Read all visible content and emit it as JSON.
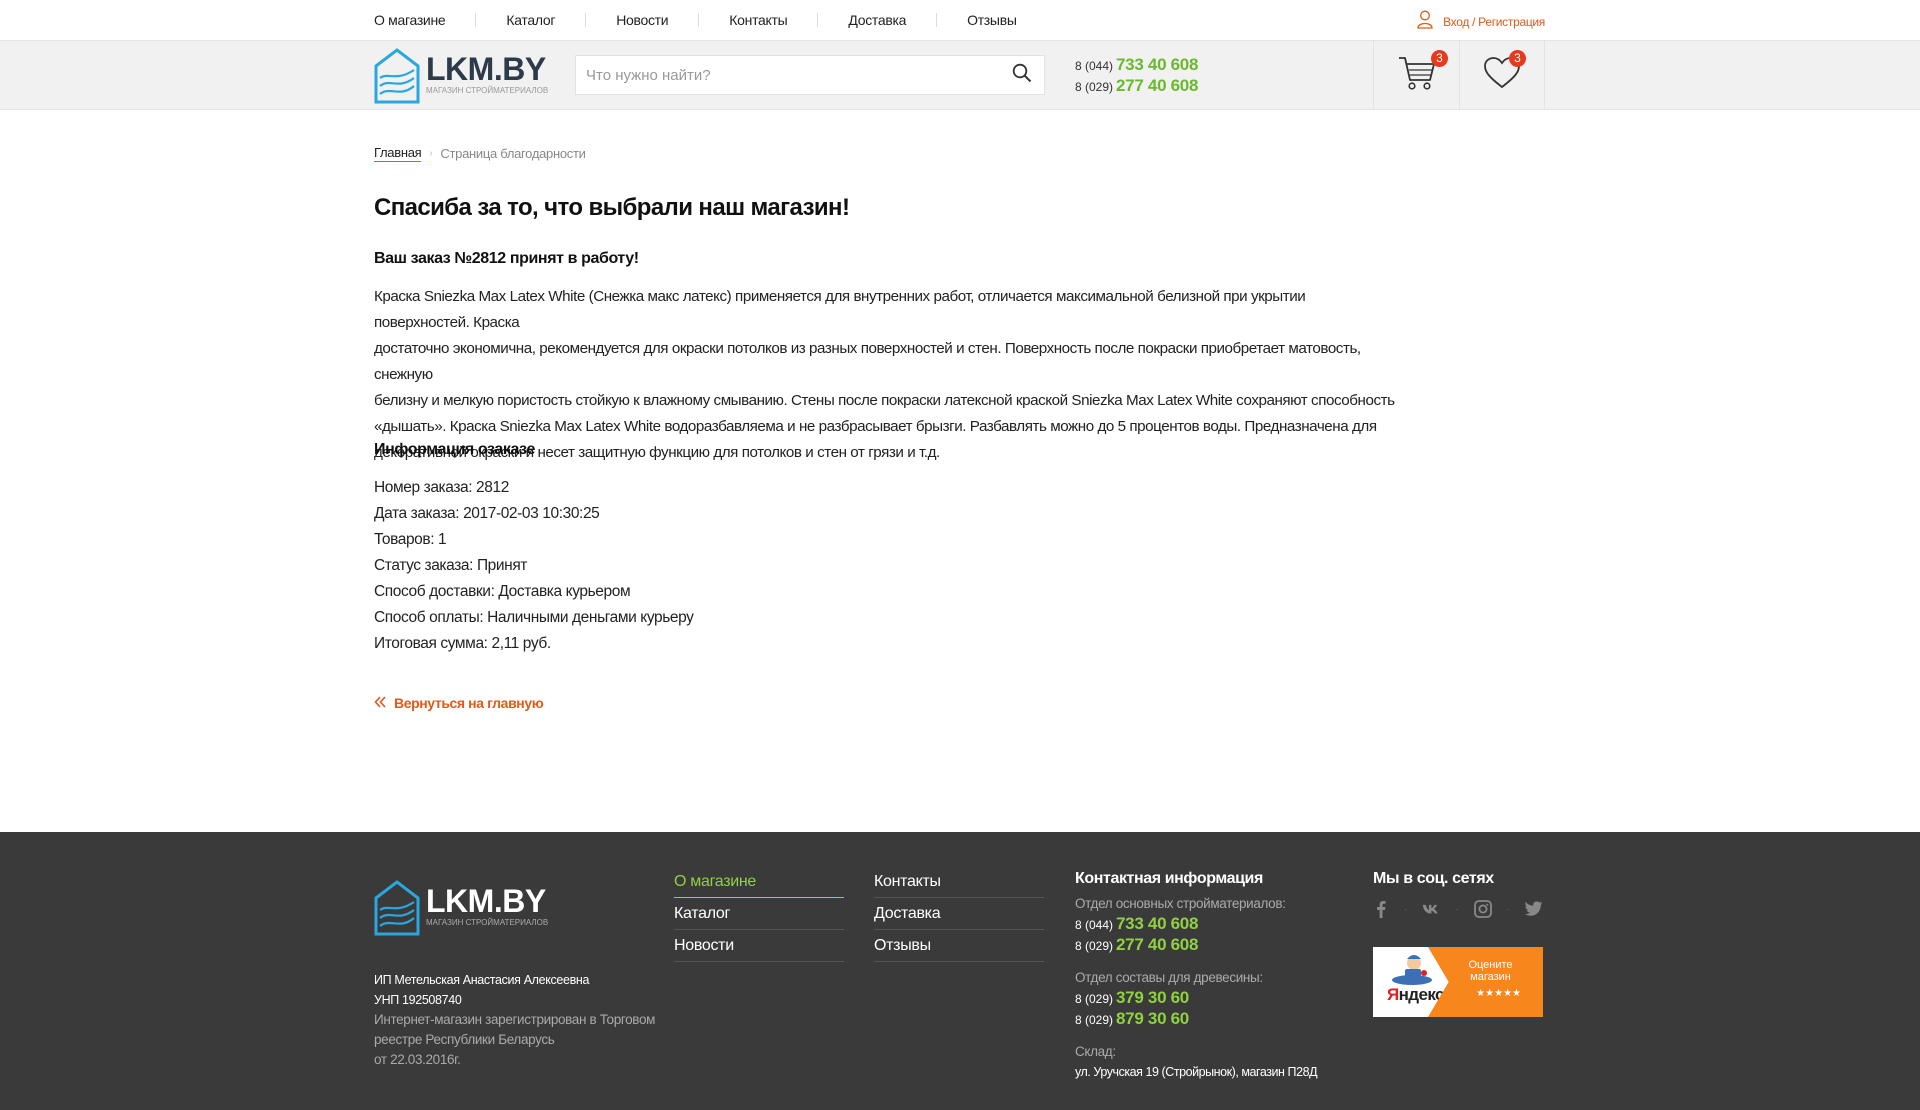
{
  "topnav": {
    "items": [
      "О магазине",
      "Каталог",
      "Новости",
      "Контакты",
      "Доставка",
      "Отзывы"
    ],
    "login": "Вход / Регистрация"
  },
  "header": {
    "logo_title": "LKM.BY",
    "logo_sub": "МАГАЗИН СТРОЙМАТЕРИАЛОВ",
    "search_placeholder": "Что нужно найти?",
    "phones": [
      {
        "code": "8 (044)",
        "number": "733 40 608"
      },
      {
        "code": "8 (029)",
        "number": "277 40 608"
      }
    ],
    "cart_count": "3",
    "favorites_count": "3"
  },
  "breadcrumb": {
    "home": "Главная",
    "current": "Страница благодарности"
  },
  "main": {
    "title": "Спасиба за то, что выбрали наш магазин!",
    "order_accepted": "Ваш заказ №2812 принят в работу!",
    "description_lines": [
      "Краска Sniezka Max Latex White (Снежка макс латекс) применяется для внутренних работ, отличается максимальной белизной при укрытии поверхностей. Краска",
      "достаточно экономична, рекомендуется для окраски потолков из разных поверхностей и стен. Поверхность после покраски приобретает матовость, снежную",
      "белизну и мелкую пористость стойкую к влажному смыванию. Стены после покраски латексной краской Sniezka Max Latex White сохраняют способность",
      "«дышать». Краска Sniezka Max Latex White водоразбавляема и не разбрасывает брызги. Разбавлять можно до 5 процентов воды. Предназначена для",
      "декоративной окраски и несет защитную функцию для потолков и стен от грязи и т.д."
    ],
    "info_title": "Информация озаказе",
    "details": [
      "Номер заказа: 2812",
      "Дата заказа: 2017-02-03 10:30:25",
      "Товаров: 1",
      "Статус заказа: Принят",
      "Способ доставки: Доставка курьером",
      "Способ оплаты: Наличными деньгами курьеру",
      "Итоговая сумма: 2,11 руб."
    ],
    "back_link": "Вернуться на главную"
  },
  "footer": {
    "logo_title": "LKM.BY",
    "logo_sub": "МАГАЗИН СТРОЙМАТЕРИАЛОВ",
    "company_name": "ИП Метельская Анастасия Алексеевна",
    "unp": "УНП 192508740",
    "registry_1": "Интернет-магазин зарегистрирован в Торговом",
    "registry_2": "реестре Республики Беларусь",
    "registry_3": "от 22.03.2016г.",
    "menu_col1": [
      "О магазине",
      "Каталог",
      "Новости"
    ],
    "menu_col2": [
      "Контакты",
      "Доставка",
      "Отзывы"
    ],
    "contacts_title": "Контактная информация",
    "dept1_label": "Отдел основных стройматериалов:",
    "dept1_phones": [
      {
        "code": "8 (044)",
        "number": "733 40 608"
      },
      {
        "code": "8 (029)",
        "number": "277 40 608"
      }
    ],
    "dept2_label": "Отдел составы для древесины:",
    "dept2_phones": [
      {
        "code": "8 (029)",
        "number": "379 30 60"
      },
      {
        "code": "8 (029)",
        "number": "879 30 60"
      }
    ],
    "warehouse_label": "Склад:",
    "warehouse_addr": "ул. Уручская 19 (Стройрынок), магазин П28Д",
    "social_title": "Мы в соц. сетях",
    "yandex_rate": "Оцените магазин",
    "yandex_stars": "★★★★★",
    "yandex_label_first": "Я",
    "yandex_label_rest": "ндекс",
    "accent_green": "#8fd13f",
    "accent_orange": "#e05a1b"
  }
}
